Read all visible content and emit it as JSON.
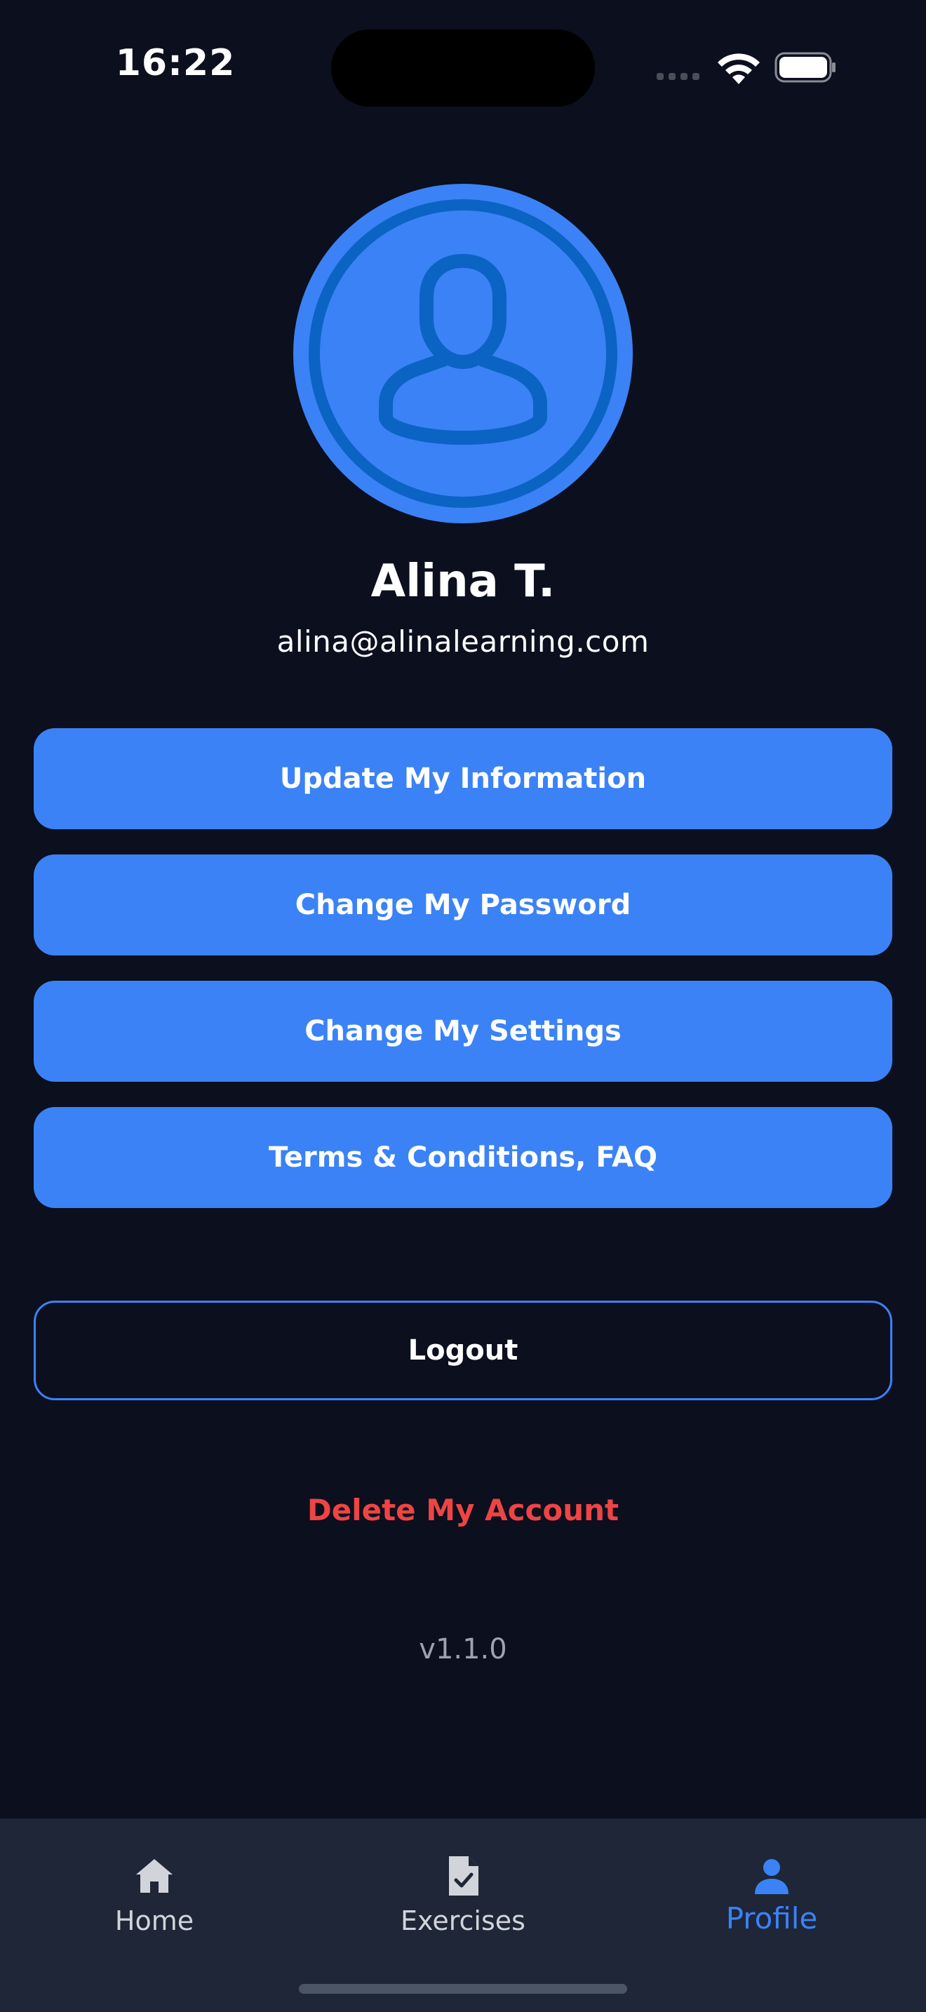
{
  "status_bar": {
    "time": "16:22"
  },
  "profile": {
    "avatar_icon": "user-icon",
    "name": "Alina T.",
    "email": "alina@alinalearning.com"
  },
  "menu": {
    "items": [
      {
        "label": "Update My Information"
      },
      {
        "label": "Change My Password"
      },
      {
        "label": "Change My Settings"
      },
      {
        "label": "Terms & Conditions, FAQ"
      }
    ]
  },
  "logout_label": "Logout",
  "delete_account_label": "Delete My Account",
  "version": "v1.1.0",
  "tab_bar": {
    "tabs": [
      {
        "label": "Home",
        "icon": "home-icon",
        "active": false
      },
      {
        "label": "Exercises",
        "icon": "checked-document-icon",
        "active": false
      },
      {
        "label": "Profile",
        "icon": "user-icon",
        "active": true
      }
    ]
  },
  "colors": {
    "background": "#0b0f1e",
    "accent": "#3b82f6",
    "danger": "#ef4444",
    "tab_bar": "#1e2637"
  }
}
